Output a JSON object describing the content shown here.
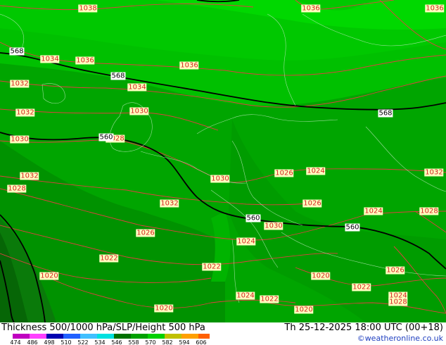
{
  "title": "Thickness 500/1000 hPa/SLP/Height 500 hPa",
  "valid_time": "Th 25-12-2025 18:00 UTC (00+18)",
  "credit": "©weatheronline.co.uk",
  "legend": {
    "ticks": [
      "474",
      "486",
      "498",
      "510",
      "522",
      "534",
      "546",
      "558",
      "570",
      "582",
      "594",
      "606"
    ],
    "colors": [
      "#c000c0",
      "#ff40ff",
      "#0000b0",
      "#2060ff",
      "#40c0ff",
      "#00e0e0",
      "#007000",
      "#00a000",
      "#00d000",
      "#c0c000",
      "#ffa000",
      "#ff6000"
    ]
  },
  "map": {
    "shading_colors": [
      "#0a700a",
      "#008a00",
      "#00a500",
      "#00c200",
      "#00d800"
    ],
    "isobar_color": "#e04040",
    "height_color": "#000000",
    "pressure_labels": [
      "1038",
      "1036",
      "1034",
      "1036",
      "1036",
      "1034",
      "1032",
      "1030",
      "1032",
      "1028",
      "1030",
      "1026",
      "1024",
      "1030",
      "1032",
      "1028",
      "1026",
      "1024",
      "1028",
      "1030",
      "1032",
      "1026",
      "1024",
      "1022",
      "1022",
      "1020",
      "1020",
      "1020",
      "1022",
      "1024",
      "1026",
      "1022",
      "1024",
      "1028",
      "1020",
      "1032",
      "1036"
    ],
    "height_labels": [
      "568",
      "568",
      "568",
      "560",
      "560",
      "560"
    ]
  }
}
